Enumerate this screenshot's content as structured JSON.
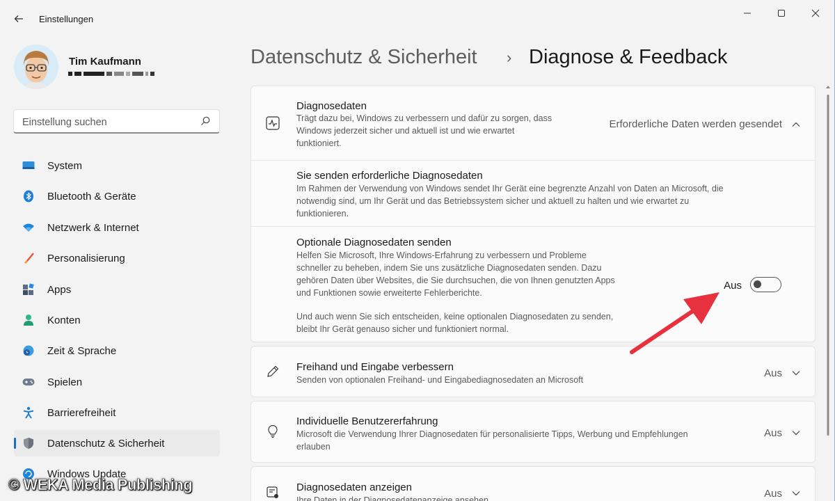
{
  "app": {
    "title": "Einstellungen"
  },
  "profile": {
    "name": "Tim Kaufmann"
  },
  "search": {
    "placeholder": "Einstellung suchen"
  },
  "sidebar": {
    "items": [
      {
        "label": "System",
        "icon": "system-icon"
      },
      {
        "label": "Bluetooth & Geräte",
        "icon": "bluetooth-icon"
      },
      {
        "label": "Netzwerk & Internet",
        "icon": "wifi-icon"
      },
      {
        "label": "Personalisierung",
        "icon": "brush-icon"
      },
      {
        "label": "Apps",
        "icon": "apps-icon"
      },
      {
        "label": "Konten",
        "icon": "account-icon"
      },
      {
        "label": "Zeit & Sprache",
        "icon": "globe-clock-icon"
      },
      {
        "label": "Spielen",
        "icon": "gamepad-icon"
      },
      {
        "label": "Barrierefreiheit",
        "icon": "accessibility-icon"
      },
      {
        "label": "Datenschutz & Sicherheit",
        "icon": "shield-icon",
        "active": true
      },
      {
        "label": "Windows Update",
        "icon": "update-icon"
      }
    ]
  },
  "header": {
    "parent": "Datenschutz & Sicherheit",
    "separator": "›",
    "current": "Diagnose & Feedback"
  },
  "diagnosedaten": {
    "title": "Diagnosedaten",
    "desc_line1": "Trägt dazu bei, Windows zu verbessern und dafür zu sorgen, dass",
    "desc_line2": "Windows jederzeit sicher und aktuell ist und wie erwartet",
    "desc_line3": "funktioniert.",
    "status": "Erforderliche Daten werden gesendet",
    "required": {
      "title": "Sie senden erforderliche Diagnosedaten",
      "desc_line1": "Im Rahmen der Verwendung von Windows sendet Ihr Gerät eine begrenzte Anzahl von Daten an Microsoft, die",
      "desc_line2": "notwendig sind, um Ihr Gerät und das Betriebssystem sicher und aktuell zu halten und wie erwartet zu",
      "desc_line3": "funktionieren."
    },
    "optional": {
      "title": "Optionale Diagnosedaten senden",
      "desc_line1": "Helfen Sie Microsoft, Ihre Windows-Erfahrung zu verbessern und Probleme",
      "desc_line2": "schneller zu beheben, indem Sie uns zusätzliche Diagnosedaten senden. Dazu",
      "desc_line3": "gehören Daten über Websites, die Sie durchsuchen, die von Ihnen genutzten Apps",
      "desc_line4": "und Funktionen sowie erweiterte Fehlerberichte.",
      "note_line1": "Und auch wenn Sie sich entscheiden, keine optionalen Diagnosedaten zu senden,",
      "note_line2": "bleibt Ihr Gerät genauso sicher und funktioniert normal.",
      "toggle_label": "Aus",
      "toggle_on": false
    }
  },
  "freihand": {
    "title": "Freihand und Eingabe verbessern",
    "desc": "Senden von optionalen Freihand- und Eingabediagnosedaten an Microsoft",
    "status": "Aus"
  },
  "individuell": {
    "title": "Individuelle Benutzererfahrung",
    "desc_line1": "Microsoft die Verwendung Ihrer Diagnosedaten für personalisierte Tipps, Werbung und Empfehlungen",
    "desc_line2": "erlauben",
    "status": "Aus"
  },
  "anzeigen": {
    "title": "Diagnosedaten anzeigen",
    "desc": "Ihre Daten in der Diagnosedatenanzeige ansehen",
    "status": "Aus"
  },
  "watermark": "© WEKA Media Publishing",
  "colors": {
    "accent": "#1a6fbf",
    "arrow": "#e8313f",
    "background": "#f3f3f3",
    "card": "#fbfbfb"
  }
}
